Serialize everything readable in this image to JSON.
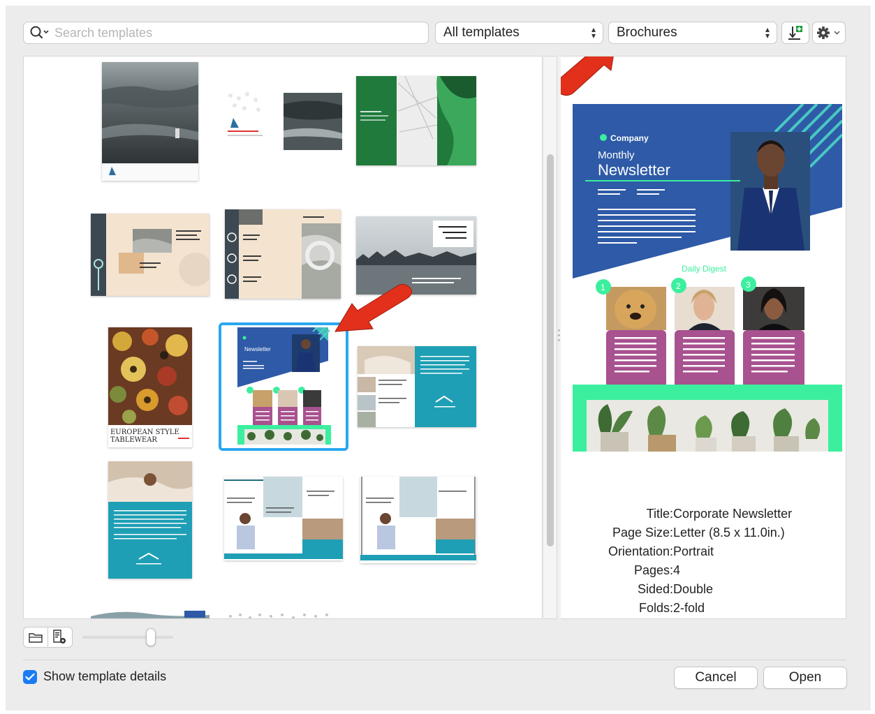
{
  "search": {
    "placeholder": "Search templates",
    "value": ""
  },
  "filters": {
    "source_selected": "All templates",
    "category_selected": "Brochures"
  },
  "toolbar": {
    "import_icon": "import-template-icon",
    "settings_icon": "gear-icon"
  },
  "thumbnails": [
    {
      "id": "beach-flyer",
      "type": "beach-portrait"
    },
    {
      "id": "beach-trifold",
      "type": "beach-landscape"
    },
    {
      "id": "green-brochure",
      "type": "green"
    },
    {
      "id": "beige-map",
      "type": "beige-a"
    },
    {
      "id": "beige-numbered",
      "type": "beige-b"
    },
    {
      "id": "bay-islands",
      "type": "bay"
    },
    {
      "id": "tableware",
      "type": "floral",
      "text": [
        "EUROPEAN STYLE",
        "TABLEWEAR"
      ]
    },
    {
      "id": "corporate-newsletter",
      "type": "newsletter",
      "selected": true,
      "text": [
        "Newsletter"
      ]
    },
    {
      "id": "real-estate-a",
      "type": "teal-a"
    },
    {
      "id": "real-estate-b",
      "type": "teal-portrait"
    },
    {
      "id": "real-estate-c",
      "type": "teal-b"
    },
    {
      "id": "real-estate-d",
      "type": "teal-c"
    }
  ],
  "preview": {
    "company": "Company",
    "monthly": "Monthly",
    "newsletter": "Newsletter",
    "daily_digest": "Daily Digest",
    "numbers": [
      "1",
      "2",
      "3"
    ],
    "colors": {
      "blue": "#2e5aa7",
      "green": "#3bef9e",
      "purple": "#a8528f",
      "teal": "#4dd4c4"
    }
  },
  "details": [
    {
      "label": "Title:",
      "value": "Corporate Newsletter"
    },
    {
      "label": "Page Size:",
      "value": "Letter (8.5 x 11.0in.)"
    },
    {
      "label": "Orientation:",
      "value": "Portrait"
    },
    {
      "label": "Pages:",
      "value": "4"
    },
    {
      "label": "Sided:",
      "value": "Double"
    },
    {
      "label": "Folds:",
      "value": "2-fold"
    }
  ],
  "bottom": {
    "show_details_label": "Show template details",
    "show_details_checked": true,
    "zoom_level": 0.75
  },
  "buttons": {
    "cancel": "Cancel",
    "open": "Open"
  },
  "annotation_color": "#e2301b"
}
